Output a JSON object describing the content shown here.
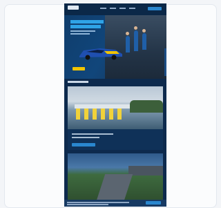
{
  "page": {
    "background": "#f3f5f8",
    "card_background": "#fbfcfd"
  },
  "site": {
    "theme": {
      "navy": "#0d2a4d",
      "accent_blue": "#2a87cf",
      "accent_yellow": "#f2c400"
    },
    "header": {
      "logo_icon": "brand-logo",
      "nav_links": [
        "",
        "",
        "",
        ""
      ],
      "cta_label": ""
    },
    "hero": {
      "title": "",
      "subtitle": "",
      "button_label": ""
    },
    "section": {
      "title": ""
    },
    "cards": [
      {
        "image": "pit-lane-photo",
        "text": "",
        "button_label": ""
      },
      {
        "image": "race-track-photo"
      }
    ],
    "cookie_banner": {
      "text": "",
      "button_label": ""
    }
  }
}
